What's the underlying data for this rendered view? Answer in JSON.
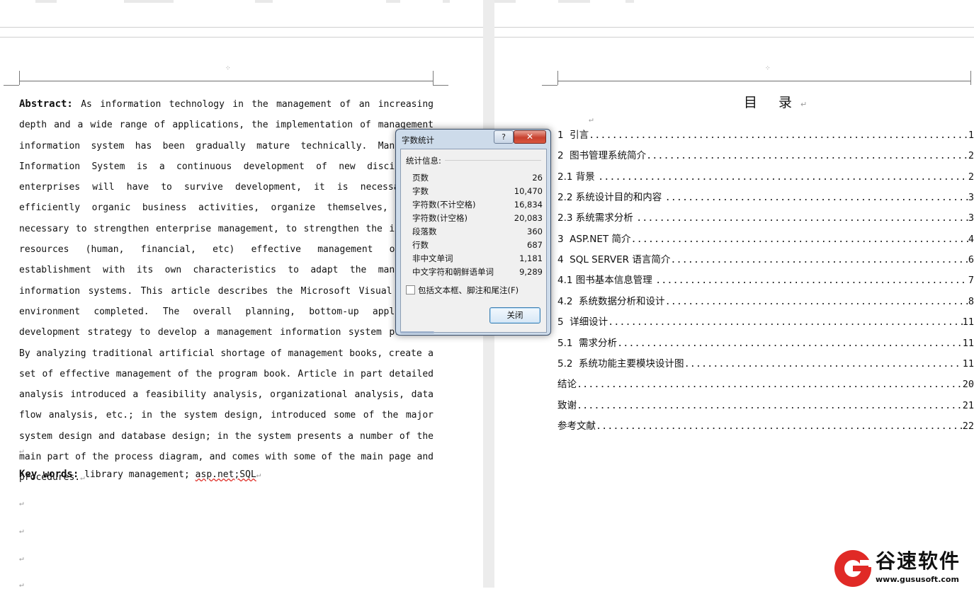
{
  "left_page": {
    "abstract_label": "Abstract:",
    "abstract_text": " As information technology in the management of an increasing depth and a wide range of applications, the implementation of management information system has been gradually mature technically. Management Information System is a continuous development of new disciplines, enterprises will have to survive development, it is necessary to efficiently organic business activities, organize themselves, it is necessary to strengthen enterprise management, to strengthen the internal resources (human, financial, etc) effective management of the establishment with its own characteristics to adapt the management information systems. This article describes the Microsoft Visual Studio environment completed. The overall planning, bottom-up application development strategy to develop a management information system process. By analyzing traditional artificial shortage of management books, create a set of effective management of the program book. Article in part detailed analysis introduced a feasibility analysis, organizational analysis, data flow analysis, etc.; in the system design, introduced some of the major system design and database design; in the system presents a number of the main part of the process diagram, and comes with some of the main page and procedures.",
    "para_mark": "↵",
    "keywords_label": "Key words:",
    "keywords_text": " library management; ",
    "keywords_misspelled": "asp.net;SQL"
  },
  "right_page": {
    "toc_title": "目 录",
    "toc": [
      {
        "title": "1  引言",
        "page": "1"
      },
      {
        "title": "2  图书管理系统简介",
        "page": "2"
      },
      {
        "title": "2.1 背景 ",
        "page": "2"
      },
      {
        "title": "2.2 系统设计目的和内容 ",
        "page": "3"
      },
      {
        "title": "2.3 系统需求分析 ",
        "page": "3"
      },
      {
        "title": "3  ASP.NET 简介",
        "page": "4"
      },
      {
        "title": "4  SQL SERVER 语言简介",
        "page": "6"
      },
      {
        "title": "4.1 图书基本信息管理 ",
        "page": "7"
      },
      {
        "title": "4.2  系统数据分析和设计",
        "page": "8"
      },
      {
        "title": "5  详细设计",
        "page": "11"
      },
      {
        "title": "5.1  需求分析",
        "page": "11"
      },
      {
        "title": "5.2  系统功能主要模块设计图",
        "page": "11"
      },
      {
        "title": "结论",
        "page": "20"
      },
      {
        "title": "致谢",
        "page": "21"
      },
      {
        "title": "参考文献",
        "page": "22"
      }
    ]
  },
  "dialog": {
    "title": "字数统计",
    "help_label": "?",
    "close_x_label": "✕",
    "group_label": "统计信息:",
    "stats": [
      {
        "label": "页数",
        "value": "26"
      },
      {
        "label": "字数",
        "value": "10,470"
      },
      {
        "label": "字符数(不计空格)",
        "value": "16,834"
      },
      {
        "label": "字符数(计空格)",
        "value": "20,083"
      },
      {
        "label": "段落数",
        "value": "360"
      },
      {
        "label": "行数",
        "value": "687"
      },
      {
        "label": "非中文单词",
        "value": "1,181"
      },
      {
        "label": "中文字符和朝鲜语单词",
        "value": "9,289"
      }
    ],
    "checkbox_label": "包括文本框、脚注和尾注(F)",
    "checkbox_checked": false,
    "close_button_label": "关闭"
  },
  "watermark": {
    "brand_cn": "谷速软件",
    "url": "www.gususoft.com",
    "brand_color": "#e02a26"
  }
}
